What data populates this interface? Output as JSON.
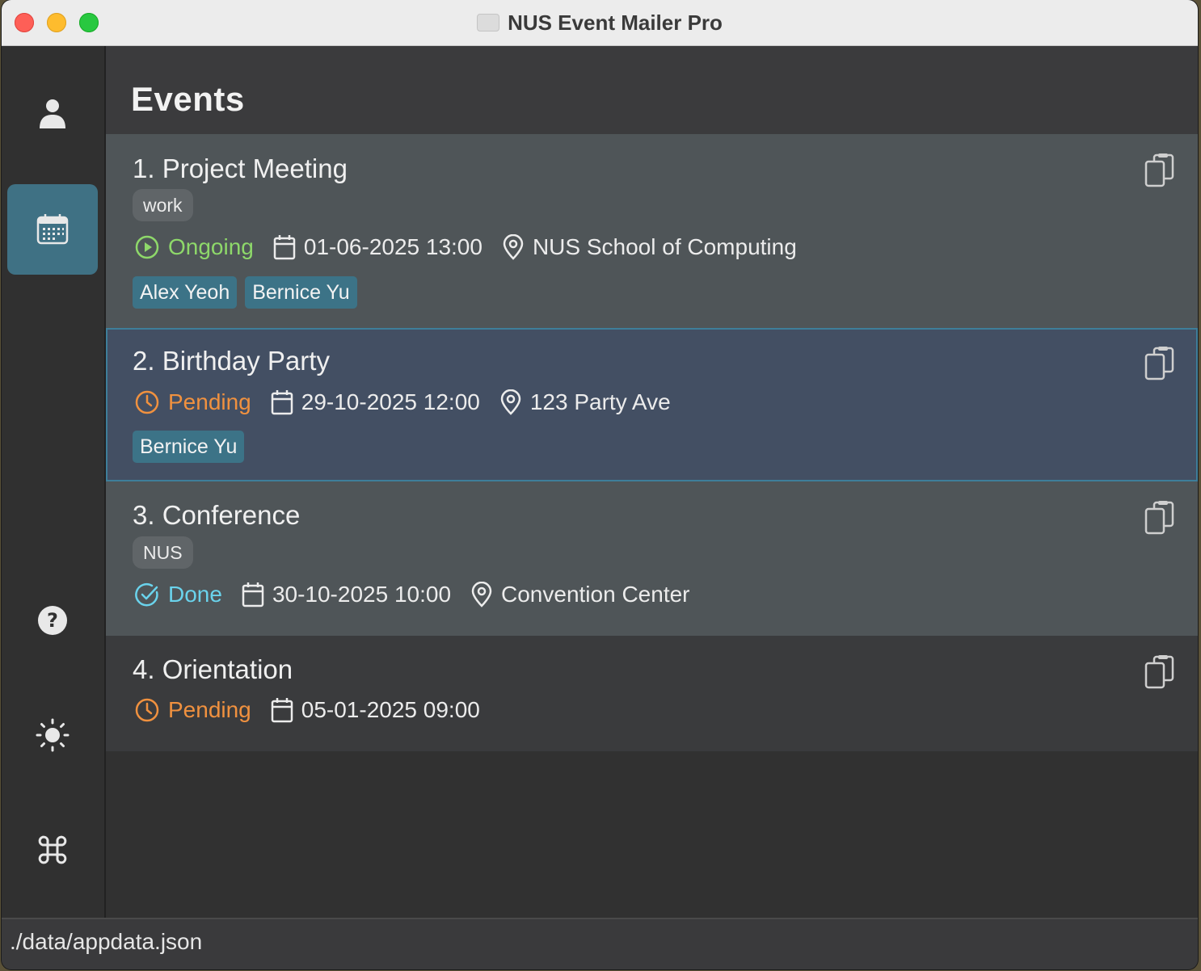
{
  "window": {
    "title": "NUS Event Mailer Pro"
  },
  "sidebar": {
    "items": [
      {
        "name": "contacts",
        "icon": "person-icon"
      },
      {
        "name": "events",
        "icon": "calendar-icon",
        "active": true
      },
      {
        "name": "help",
        "icon": "question-icon"
      },
      {
        "name": "theme",
        "icon": "sun-icon"
      },
      {
        "name": "commands",
        "icon": "command-icon"
      }
    ]
  },
  "main": {
    "title": "Events",
    "events": [
      {
        "title": "1. Project Meeting",
        "tag": "work",
        "status": "Ongoing",
        "datetime": "01-06-2025 13:00",
        "location": "NUS School of Computing",
        "attendees": [
          "Alex Yeoh",
          "Bernice Yu"
        ]
      },
      {
        "title": "2. Birthday Party",
        "status": "Pending",
        "datetime": "29-10-2025 12:00",
        "location": "123 Party Ave",
        "attendees": [
          "Bernice Yu"
        ]
      },
      {
        "title": "3. Conference",
        "tag": "NUS",
        "status": "Done",
        "datetime": "30-10-2025 10:00",
        "location": "Convention Center"
      },
      {
        "title": "4. Orientation",
        "status": "Pending",
        "datetime": "05-01-2025 09:00"
      }
    ]
  },
  "status_bar": {
    "path": "./data/appdata.json"
  },
  "colors": {
    "ongoing": "#8ed86a",
    "pending": "#f0913f",
    "done": "#6ad3ec",
    "accent": "#3f7184"
  }
}
